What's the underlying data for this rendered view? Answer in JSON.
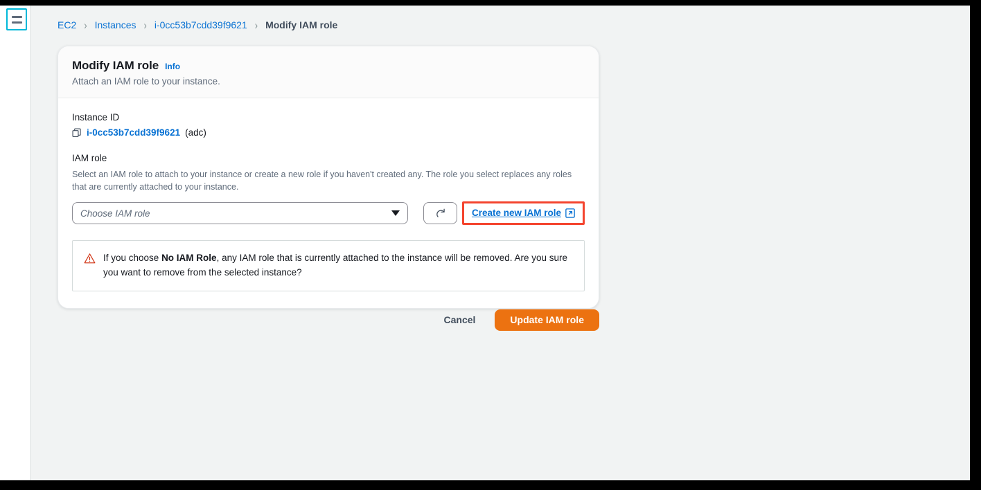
{
  "nav": {
    "menu_icon": "hamburger-menu-icon"
  },
  "breadcrumb": {
    "items": [
      {
        "label": "EC2",
        "current": false
      },
      {
        "label": "Instances",
        "current": false
      },
      {
        "label": "i-0cc53b7cdd39f9621",
        "current": false
      },
      {
        "label": "Modify IAM role",
        "current": true
      }
    ],
    "separator": "›"
  },
  "card": {
    "title": "Modify IAM role",
    "info_label": "Info",
    "subtitle": "Attach an IAM role to your instance.",
    "instance_id": {
      "label": "Instance ID",
      "copy_icon": "copy-icon",
      "value": "i-0cc53b7cdd39f9621",
      "suffix": "(adc)"
    },
    "iam_role": {
      "label": "IAM role",
      "description": "Select an IAM role to attach to your instance or create a new role if you haven't created any. The role you select replaces any roles that are currently attached to your instance.",
      "select_placeholder": "Choose IAM role",
      "select_value": "",
      "caret_icon": "chevron-down-icon",
      "refresh_icon": "refresh-icon",
      "create_link_label": "Create new IAM role",
      "external_link_icon": "external-link-icon"
    },
    "warning": {
      "icon": "warning-triangle-icon",
      "text_before": "If you choose ",
      "text_bold": "No IAM Role",
      "text_after": ", any IAM role that is currently attached to the instance will be removed. Are you sure you want to remove from the selected instance?"
    }
  },
  "actions": {
    "cancel_label": "Cancel",
    "submit_label": "Update IAM role"
  },
  "colors": {
    "link": "#0972d3",
    "primary_button": "#ec7211",
    "highlight_box": "#f4442e",
    "warning_icon": "#d13212",
    "focus_ring": "#00b8d9",
    "page_background": "#f1f3f3"
  }
}
